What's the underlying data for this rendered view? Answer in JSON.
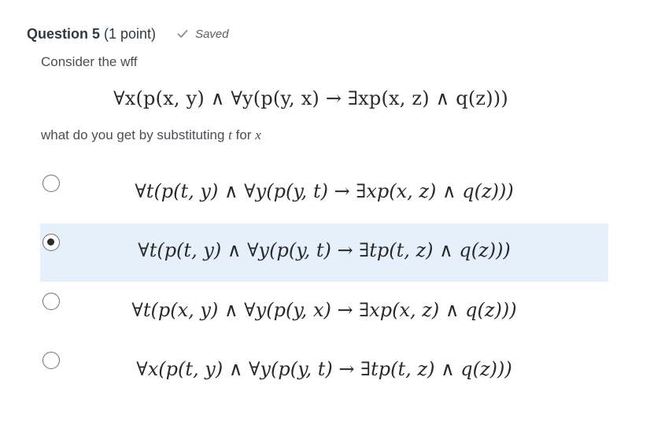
{
  "question": {
    "title": "Question 5",
    "points": "(1 point)",
    "saved_label": "Saved",
    "prompt": "Consider the wff",
    "formula": "∀x(p(x, y) ∧ ∀y(p(y, x) → ∃xp(x, z) ∧ q(z)))",
    "subst_prefix": "what do you get by substituting ",
    "subst_var_new": "t",
    "subst_mid": " for ",
    "subst_var_old": "x"
  },
  "options": [
    {
      "formula": "∀t(p(t, y) ∧ ∀y(p(y, t) → ∃xp(x, z) ∧ q(z)))",
      "selected": false
    },
    {
      "formula": "∀t(p(t, y) ∧ ∀y(p(y, t) → ∃tp(t, z) ∧ q(z)))",
      "selected": true
    },
    {
      "formula": "∀t(p(x, y) ∧ ∀y(p(y, x) → ∃xp(x, z) ∧ q(z)))",
      "selected": false
    },
    {
      "formula": "∀x(p(t, y) ∧ ∀y(p(y, t) → ∃tp(t, z) ∧ q(z)))",
      "selected": false
    }
  ],
  "colors": {
    "selected_bg": "#e5f0fb",
    "check": "#8a8d91"
  },
  "icons": {
    "saved": "check-icon",
    "radio": "radio-button"
  }
}
